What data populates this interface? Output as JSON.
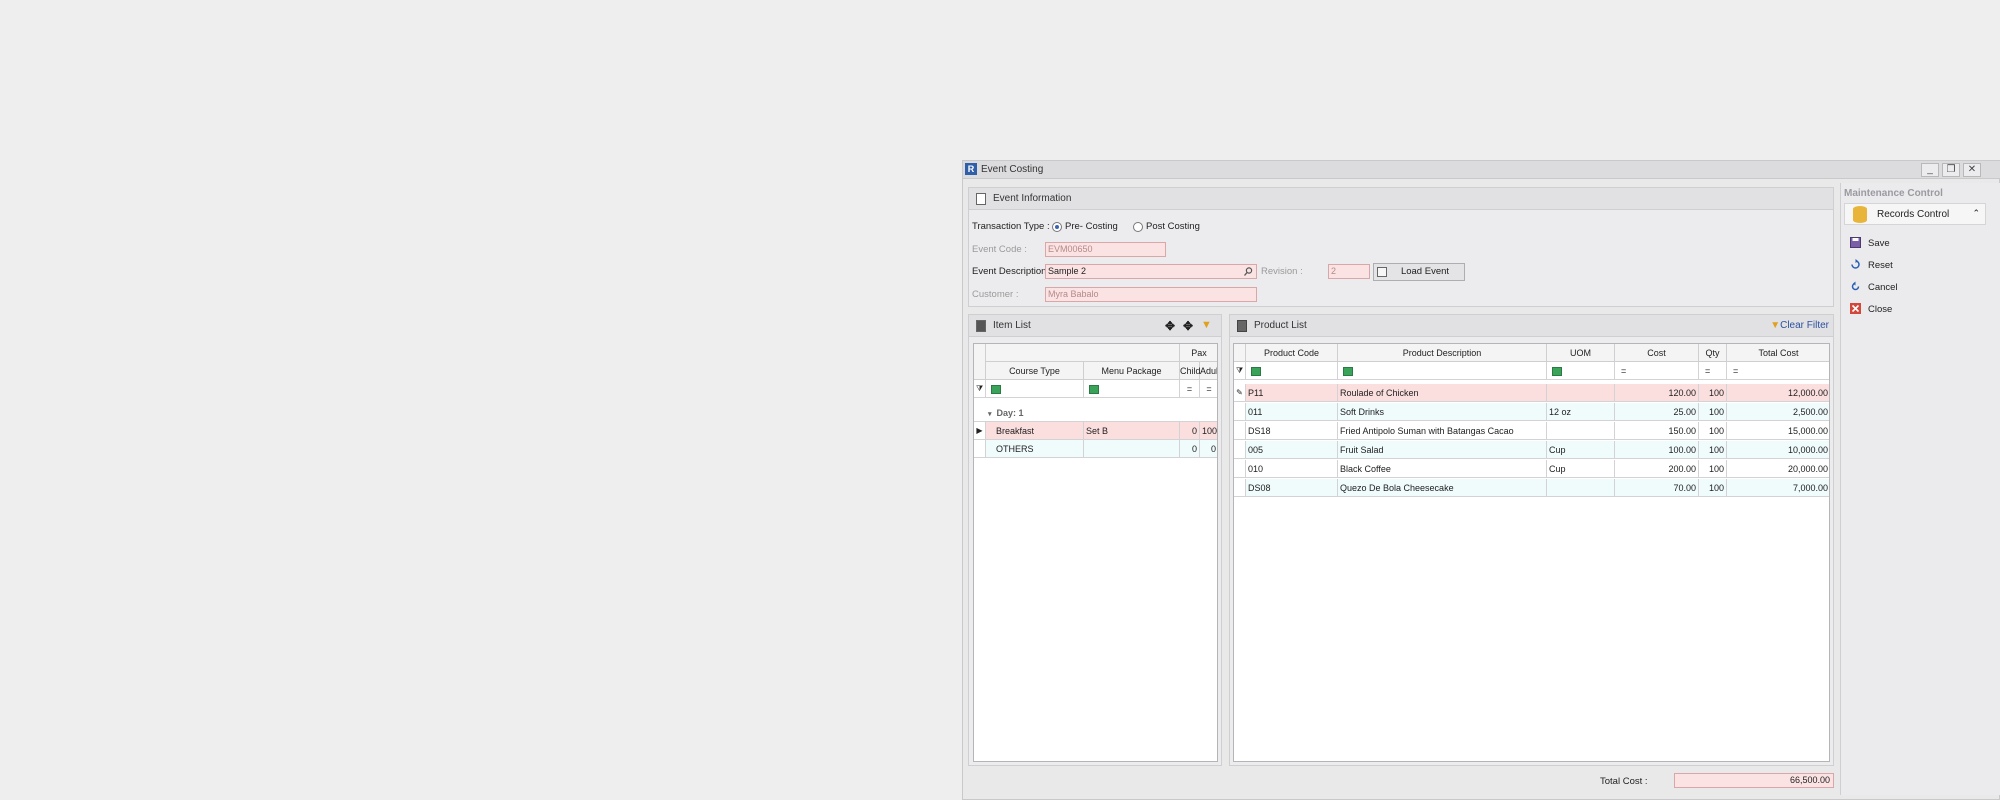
{
  "window": {
    "app_icon": "R",
    "title": "Event Costing",
    "min_glyph": "_",
    "max_glyph": "❐",
    "close_glyph": "✕"
  },
  "event_info": {
    "header": "Event Information",
    "transaction_type_label": "Transaction Type :",
    "pre_costing": "Pre- Costing",
    "post_costing": "Post Costing",
    "selected_transaction": "Pre- Costing",
    "event_code_label": "Event Code :",
    "event_code_value": "EVM00650",
    "event_description_label": "Event Description :",
    "event_description_value": "Sample 2",
    "revision_label": "Revision :",
    "revision_value": "2",
    "load_event_button": "Load Event",
    "customer_label": "Customer :",
    "customer_value": "Myra  Babalo"
  },
  "item_list": {
    "header": "Item List",
    "group_header": "Pax",
    "columns": [
      "Course Type",
      "Menu Package",
      "Child",
      "Adult"
    ],
    "filter_eq": "=",
    "group_row": "Day: 1",
    "rows": [
      {
        "course_type": "Breakfast",
        "menu_package": "Set B",
        "child": "0",
        "adult": "100"
      },
      {
        "course_type": "OTHERS",
        "menu_package": "",
        "child": "0",
        "adult": "0"
      }
    ]
  },
  "product_list": {
    "header": "Product List",
    "clear_filter": "Clear Filter",
    "columns": [
      "Product Code",
      "Product Description",
      "UOM",
      "Cost",
      "Qty",
      "Total Cost"
    ],
    "filter_eq": "=",
    "rows": [
      {
        "code": "P11",
        "description": "Roulade of Chicken",
        "uom": "",
        "cost": "120.00",
        "qty": "100",
        "total": "12,000.00"
      },
      {
        "code": "011",
        "description": "Soft Drinks",
        "uom": "12 oz",
        "cost": "25.00",
        "qty": "100",
        "total": "2,500.00"
      },
      {
        "code": "DS18",
        "description": " Fried Antipolo Suman with Batangas Cacao",
        "uom": "",
        "cost": "150.00",
        "qty": "100",
        "total": "15,000.00"
      },
      {
        "code": "005",
        "description": "Fruit Salad",
        "uom": "Cup",
        "cost": "100.00",
        "qty": "100",
        "total": "10,000.00"
      },
      {
        "code": "010",
        "description": "Black Coffee",
        "uom": "Cup",
        "cost": "200.00",
        "qty": "100",
        "total": "20,000.00"
      },
      {
        "code": "DS08",
        "description": "Quezo De Bola Cheesecake",
        "uom": "",
        "cost": "70.00",
        "qty": "100",
        "total": "7,000.00"
      }
    ],
    "total_cost_label": "Total Cost :",
    "total_cost_value": "66,500.00"
  },
  "sidebar": {
    "title": "Maintenance Control",
    "records_control": "Records Control",
    "records_chevron": "⌃",
    "items": [
      "Save",
      "Reset",
      "Cancel",
      "Close"
    ]
  },
  "colors": {
    "pink_field": "#fbe3e3",
    "cyan_row": "#f0fbfc",
    "accent": "#3b63b5"
  }
}
